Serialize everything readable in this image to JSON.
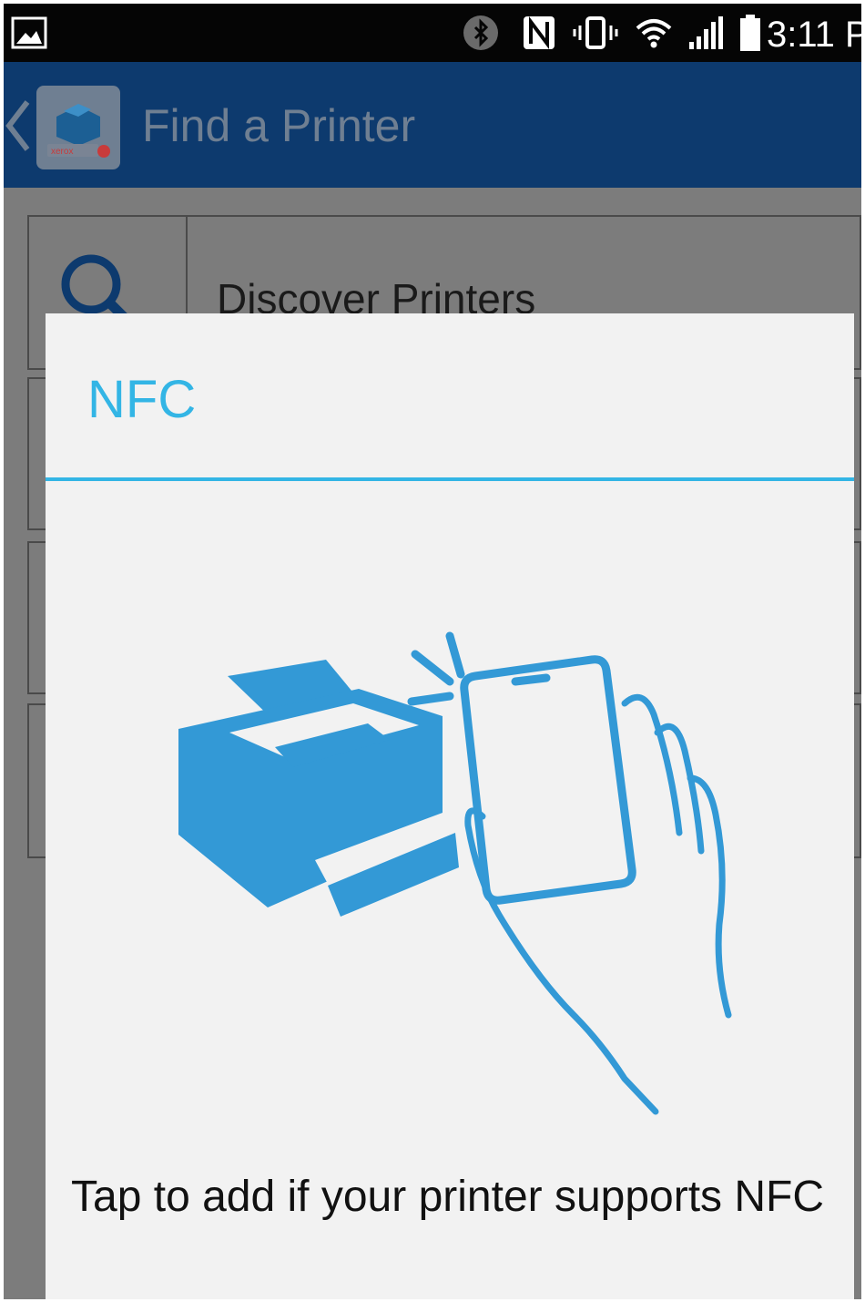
{
  "status_bar": {
    "time": "3:11 P",
    "icons": [
      "gallery-icon",
      "bluetooth-icon",
      "nfc-icon",
      "vibrate-icon",
      "wifi-icon",
      "signal-icon",
      "battery-icon"
    ]
  },
  "action_bar": {
    "title": "Find a Printer",
    "logo_text": "xerox"
  },
  "list": {
    "discover_label": "Discover Printers"
  },
  "dialog": {
    "title": "NFC",
    "message": "Tap to add if your printer supports NFC"
  },
  "colors": {
    "accent": "#33b5e5",
    "actionbar": "#0d3a6e",
    "dim_overlay": "#7c7c7c",
    "dialog_bg": "#f2f2f2",
    "illustration": "#3399d6"
  }
}
